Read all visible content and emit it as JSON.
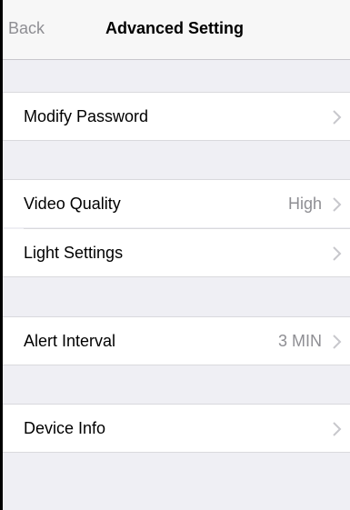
{
  "navbar": {
    "back_label": "Back",
    "title": "Advanced Setting"
  },
  "sections": [
    {
      "items": [
        {
          "label": "Modify Password",
          "value": "",
          "icon": "chevron-right-icon"
        }
      ]
    },
    {
      "items": [
        {
          "label": "Video Quality",
          "value": "High",
          "icon": "chevron-right-icon"
        },
        {
          "label": "Light Settings",
          "value": "",
          "icon": "chevron-right-icon"
        }
      ]
    },
    {
      "items": [
        {
          "label": "Alert Interval",
          "value": "3 MIN",
          "icon": "chevron-right-icon"
        }
      ]
    },
    {
      "items": [
        {
          "label": "Device Info",
          "value": "",
          "icon": "chevron-right-icon"
        }
      ]
    }
  ],
  "colors": {
    "background": "#efeff4",
    "cell": "#ffffff",
    "secondary_text": "#8e8e93",
    "chevron": "#c7c7cc"
  }
}
